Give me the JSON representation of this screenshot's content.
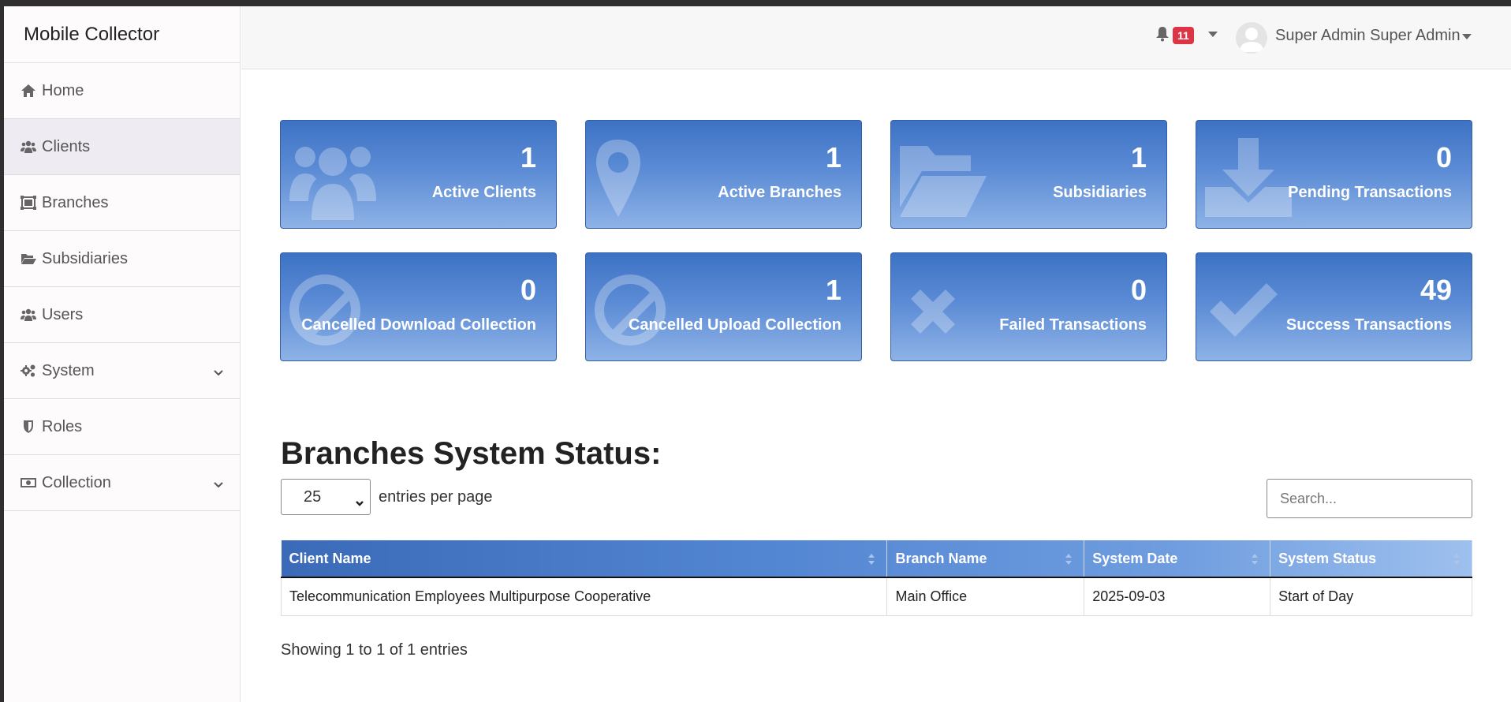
{
  "sidebar": {
    "brand": "Mobile Collector",
    "items": [
      {
        "label": "Home",
        "icon": "home-icon"
      },
      {
        "label": "Clients",
        "icon": "users-icon",
        "active": true
      },
      {
        "label": "Branches",
        "icon": "branch-icon"
      },
      {
        "label": "Subsidiaries",
        "icon": "folder-open-icon"
      },
      {
        "label": "Users",
        "icon": "users-icon"
      },
      {
        "label": "System",
        "icon": "gears-icon",
        "expandable": true
      },
      {
        "label": "Roles",
        "icon": "shield-icon"
      },
      {
        "label": "Collection",
        "icon": "money-icon",
        "expandable": true
      }
    ]
  },
  "topbar": {
    "notification_count": "11",
    "user_name": "Super Admin Super Admin"
  },
  "cards": [
    {
      "value": "1",
      "label": "Active Clients",
      "icon": "users-icon"
    },
    {
      "value": "1",
      "label": "Active Branches",
      "icon": "map-marker-icon"
    },
    {
      "value": "1",
      "label": "Subsidiaries",
      "icon": "folder-open-icon"
    },
    {
      "value": "0",
      "label": "Pending Transactions",
      "icon": "download-icon"
    },
    {
      "value": "0",
      "label": "Cancelled Download Collection",
      "icon": "ban-icon"
    },
    {
      "value": "1",
      "label": "Cancelled Upload Collection",
      "icon": "ban-icon"
    },
    {
      "value": "0",
      "label": "Failed Transactions",
      "icon": "times-icon"
    },
    {
      "value": "49",
      "label": "Success Transactions",
      "icon": "check-icon"
    }
  ],
  "section": {
    "title": "Branches System Status:",
    "entries_value": "25",
    "entries_label": "entries per page",
    "search_placeholder": "Search...",
    "info": "Showing 1 to 1 of 1 entries"
  },
  "table": {
    "headers": [
      "Client Name",
      "Branch Name",
      "System Date",
      "System Status"
    ],
    "rows": [
      [
        "Telecommunication Employees Multipurpose Cooperative",
        "Main Office",
        "2025-09-03",
        "Start of Day"
      ]
    ]
  },
  "colors": {
    "card_top": "#3d72c4",
    "card_bottom": "#8db2e6",
    "badge": "#dc3545",
    "sidebar_active": "#efebf3"
  }
}
